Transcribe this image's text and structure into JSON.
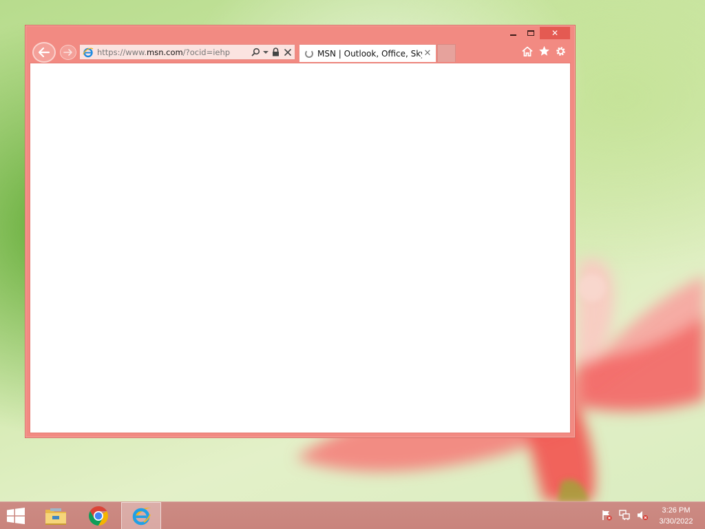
{
  "browser": {
    "address": {
      "scheme": "https://www.",
      "domain": "msn.com",
      "rest": "/?ocid=iehp"
    },
    "tab": {
      "title": "MSN | Outlook, Office, Sky..."
    },
    "caption": {
      "close_glyph": "✕"
    },
    "tab_close_glyph": "✕"
  },
  "taskbar": {
    "apps": [
      "file-explorer",
      "google-chrome",
      "internet-explorer"
    ],
    "active_app": "internet-explorer",
    "clock": {
      "time": "3:26 PM",
      "date": "3/30/2022"
    },
    "tray": [
      "action-center-flag-icon",
      "network-icon",
      "volume-muted-icon"
    ]
  },
  "colors": {
    "window_accent": "#f28a82",
    "taskbar": "#c9847c",
    "close_button": "#e45a52"
  }
}
